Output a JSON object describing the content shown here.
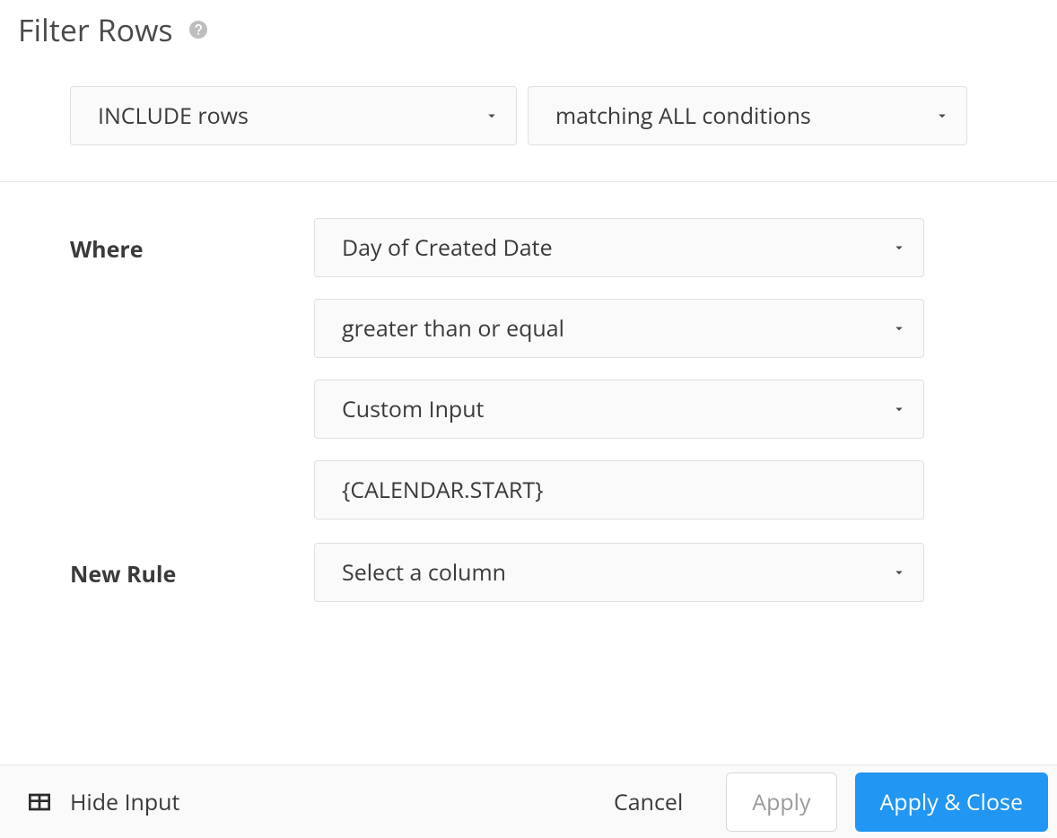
{
  "header": {
    "title": "Filter Rows"
  },
  "mode": {
    "include_label": "INCLUDE rows",
    "match_label": "matching ALL conditions"
  },
  "rules": {
    "where_label": "Where",
    "where": {
      "column": "Day of Created Date",
      "operator": "greater than or equal",
      "value_type": "Custom Input",
      "value": "{CALENDAR.START}"
    },
    "new_rule_label": "New Rule",
    "new_rule_placeholder": "Select a column"
  },
  "footer": {
    "hide_input_label": "Hide Input",
    "cancel_label": "Cancel",
    "apply_label": "Apply",
    "apply_close_label": "Apply & Close"
  }
}
